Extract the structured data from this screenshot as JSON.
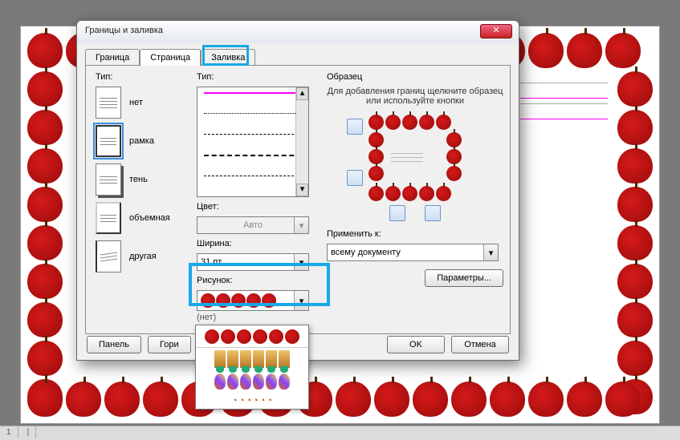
{
  "dialog": {
    "title": "Границы и заливка",
    "close": "✕",
    "tabs": {
      "border": "Граница",
      "page": "Страница",
      "fill": "Заливка"
    },
    "type_label": "Тип:",
    "settings": {
      "none": "нет",
      "box": "рамка",
      "shadow": "тень",
      "threeD": "объемная",
      "custom": "другая"
    },
    "style_label": "Тип:",
    "color_label": "Цвет:",
    "color_value": "Авто",
    "width_label": "Ширина:",
    "width_value": "31 пт",
    "art_label": "Рисунок:",
    "art_value_under": "(нет)",
    "preview_label": "Образец",
    "preview_hint": "Для добавления границ щелкните образец или используйте кнопки",
    "apply_label": "Применить к:",
    "apply_value": "всему документу",
    "options_btn": "Параметры...",
    "panel_btn": "Панель",
    "hline_btn": "Гори",
    "ok": "OK",
    "cancel": "Отмена"
  },
  "statusbar": {
    "c1": "1",
    "c2": "|"
  }
}
